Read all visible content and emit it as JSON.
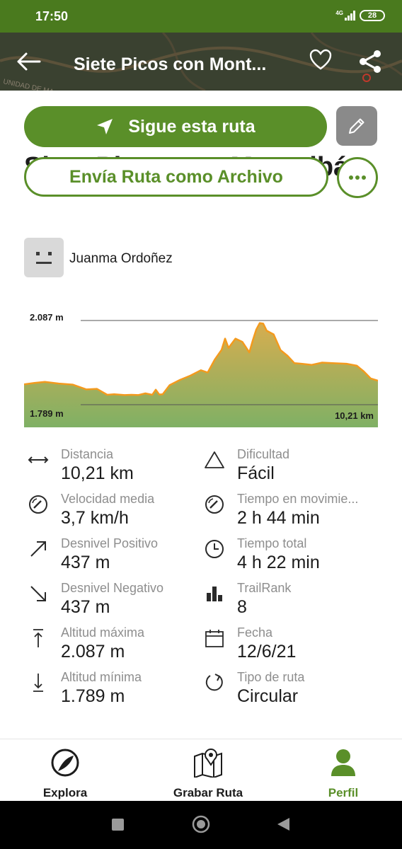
{
  "status_bar": {
    "time": "17:50",
    "network": "4G",
    "battery": "28"
  },
  "header": {
    "title": "Siete Picos con Mont...",
    "map_text": "UNIDAD DE MA"
  },
  "actions": {
    "follow_label": "Sigue esta ruta",
    "send_label": "Envía Ruta como Archivo"
  },
  "route": {
    "title": "Siete Picos con Montalbán"
  },
  "author": {
    "name": "Juanma Ordoñez"
  },
  "chart_data": {
    "type": "area",
    "max_label": "2.087 m",
    "min_label": "1.789 m",
    "distance_label": "10,21 km",
    "ylim": [
      1789,
      2087
    ],
    "xlim": [
      0,
      10.21
    ],
    "x": [
      0,
      0.3,
      0.6,
      1.0,
      1.4,
      1.8,
      2.1,
      2.4,
      2.6,
      2.9,
      3.1,
      3.3,
      3.5,
      3.7,
      3.8,
      3.9,
      4.0,
      4.2,
      4.5,
      4.8,
      5.1,
      5.3,
      5.5,
      5.7,
      5.8,
      5.9,
      6.1,
      6.3,
      6.5,
      6.6,
      6.7,
      6.8,
      6.9,
      7.0,
      7.2,
      7.4,
      7.6,
      7.8,
      8.0,
      8.3,
      8.6,
      8.9,
      9.3,
      9.6,
      9.8,
      10.0,
      10.21
    ],
    "y": [
      1861,
      1866,
      1870,
      1864,
      1860,
      1843,
      1845,
      1824,
      1826,
      1823,
      1824,
      1823,
      1829,
      1824,
      1842,
      1825,
      1826,
      1858,
      1877,
      1892,
      1911,
      1903,
      1948,
      1983,
      2023,
      1990,
      2023,
      2011,
      1974,
      2017,
      2055,
      2078,
      2076,
      2051,
      2038,
      1982,
      1962,
      1936,
      1934,
      1930,
      1938,
      1936,
      1934,
      1927,
      1907,
      1882,
      1874
    ]
  },
  "stats": [
    {
      "label": "Distancia",
      "value": "10,21 km",
      "icon": "distance-icon"
    },
    {
      "label": "Dificultad",
      "value": "Fácil",
      "icon": "triangle-icon"
    },
    {
      "label": "Velocidad media",
      "value": "3,7 km/h",
      "icon": "speedometer-icon"
    },
    {
      "label": "Tiempo en movimie...",
      "value": "2 h 44 min",
      "icon": "speedometer-icon"
    },
    {
      "label": "Desnivel Positivo",
      "value": "437 m",
      "icon": "arrow-up-right-icon"
    },
    {
      "label": "Tiempo total",
      "value": "4 h 22 min",
      "icon": "clock-icon"
    },
    {
      "label": "Desnivel Negativo",
      "value": "437 m",
      "icon": "arrow-down-right-icon"
    },
    {
      "label": "TrailRank",
      "value": "8",
      "icon": "bar-chart-icon"
    },
    {
      "label": "Altitud máxima",
      "value": "2.087 m",
      "icon": "arrow-up-bar-icon"
    },
    {
      "label": "Fecha",
      "value": "12/6/21",
      "icon": "calendar-icon"
    },
    {
      "label": "Altitud mínima",
      "value": "1.789 m",
      "icon": "arrow-down-bar-icon"
    },
    {
      "label": "Tipo de ruta",
      "value": "Circular",
      "icon": "circular-arrow-icon"
    }
  ],
  "bottom_nav": {
    "explore": "Explora",
    "record": "Grabar Ruta",
    "profile": "Perfil"
  },
  "colors": {
    "brand_green": "#5a8f29",
    "status_green": "#4a7a1e",
    "chart_line": "#f39a1e",
    "chart_fill_top": "#d7ad4f",
    "chart_fill_bottom": "#7fb065"
  }
}
